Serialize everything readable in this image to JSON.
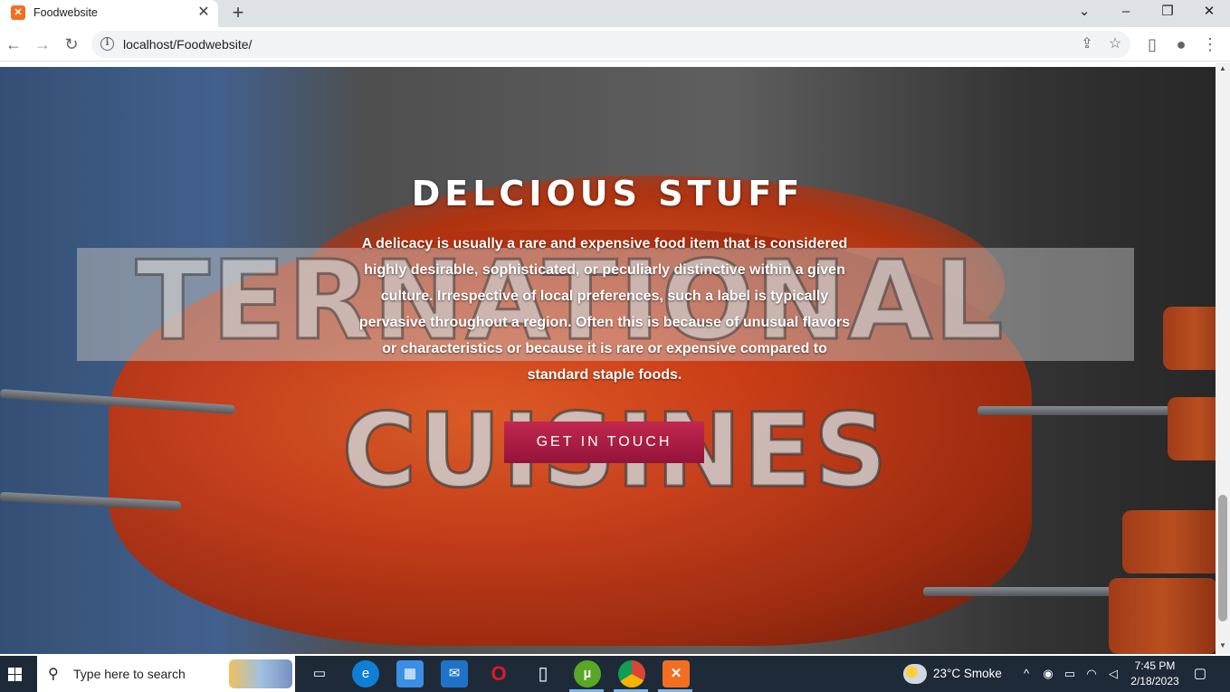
{
  "browser": {
    "tab_title": "Foodwebsite",
    "tab_favicon": "xampp-icon",
    "close_glyph": "✕",
    "new_tab_glyph": "+",
    "url": "localhost/Foodwebsite/",
    "window_controls": [
      "⌄",
      "–",
      "❐",
      "✕"
    ]
  },
  "hero": {
    "heading": "DELCIOUS STUFF",
    "description": "A delicacy is usually a rare and expensive food item that is considered highly desirable, sophisticated, or peculiarly distinctive within a given culture. Irrespective of local preferences, such a label is typically pervasive throughout a region. Often this is because of unusual flavors or characteristics or because it is rare or expensive compared to standard staple foods.",
    "cta_label": "GET IN TOUCH",
    "background_text_1": "TERNATIONAL",
    "background_text_2": "CUISINES"
  },
  "taskbar": {
    "search_placeholder": "Type here to search",
    "weather": "23°C  Smoke",
    "time": "7:45 PM",
    "date": "2/18/2023",
    "apps": [
      "task-view-icon",
      "edge-icon",
      "microsoft-store-icon",
      "mail-icon",
      "opera-icon",
      "file-icon",
      "utorrent-icon",
      "chrome-icon",
      "xampp-icon"
    ]
  },
  "colors": {
    "cta_top": "#c2284f",
    "cta_bottom": "#94133a",
    "taskbar": "#1f2a38",
    "tabstrip": "#dee1e6"
  }
}
